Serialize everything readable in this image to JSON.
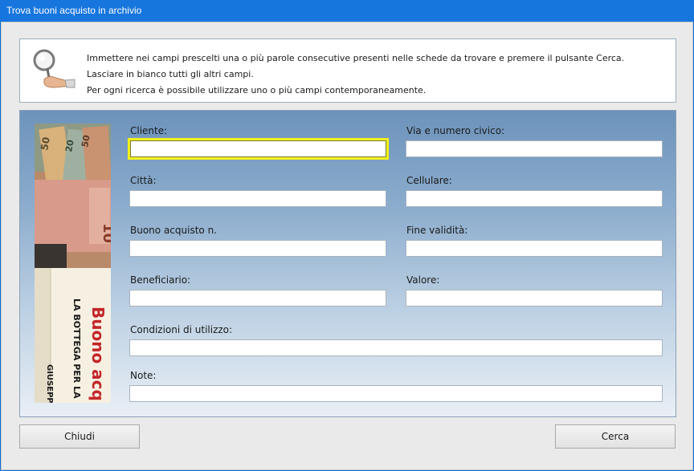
{
  "window": {
    "title": "Trova buoni acquisto in archivio"
  },
  "info": {
    "icon": "magnifier-icon",
    "lines": [
      "Immettere nei campi prescelti una o più parole consecutive presenti nelle schede da trovare e premere il pulsante Cerca.",
      "Lasciare in bianco tutti gli altri campi.",
      "Per ogni ricerca è possibile utilizzare uno o più campi contemporaneamente."
    ]
  },
  "form": {
    "cliente": {
      "label": "Cliente:",
      "value": ""
    },
    "via": {
      "label": "Via e numero civico:",
      "value": ""
    },
    "citta": {
      "label": "Città:",
      "value": ""
    },
    "cellulare": {
      "label": "Cellulare:",
      "value": ""
    },
    "buono": {
      "label": "Buono acquisto n.",
      "value": ""
    },
    "fine": {
      "label": "Fine validità:",
      "value": ""
    },
    "beneficiario": {
      "label": "Beneficiario:",
      "value": ""
    },
    "valore": {
      "label": "Valore:",
      "value": ""
    },
    "condizioni": {
      "label": "Condizioni di utilizzo:",
      "value": ""
    },
    "note": {
      "label": "Note:",
      "value": ""
    }
  },
  "side_image": {
    "banknotes": [
      "50",
      "20",
      "50",
      "10"
    ],
    "voucher_title": "Buono acq",
    "voucher_shop": "LA BOTTEGA PER LA",
    "voucher_name": "GIUSEPP"
  },
  "buttons": {
    "close": "Chiudi",
    "search": "Cerca"
  },
  "colors": {
    "titlebar": "#1776de",
    "focus_border": "#f2f21a",
    "panel_top": "#6d93bb",
    "panel_bottom": "#e9eff6"
  }
}
